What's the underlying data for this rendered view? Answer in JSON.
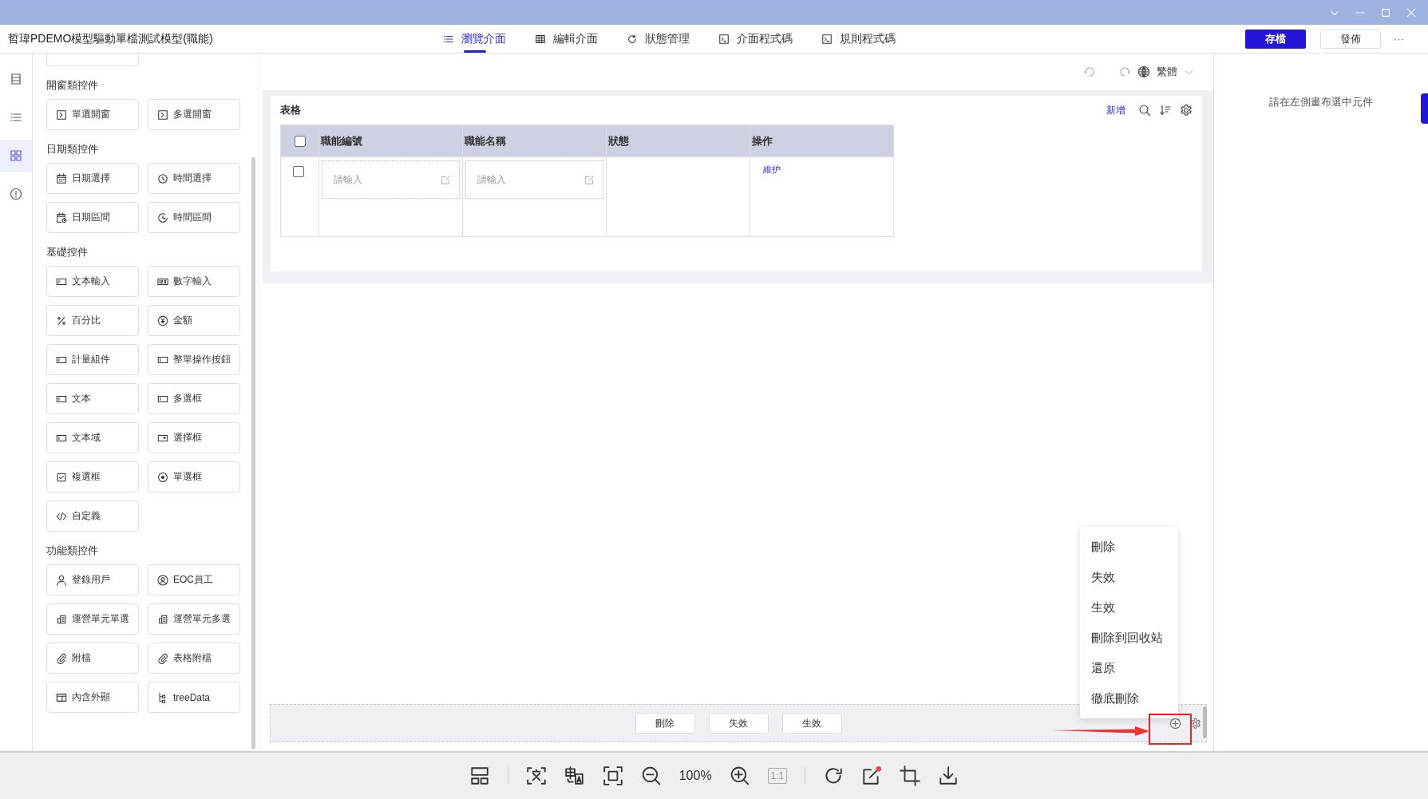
{
  "window": {
    "title": "哲瑋PDEMO模型驅動單檔測試模型(職能)"
  },
  "tabs": [
    {
      "label": "瀏覽介面",
      "selected": true,
      "kind": "list"
    },
    {
      "label": "編輯介面",
      "selected": false,
      "kind": "table"
    },
    {
      "label": "狀態管理",
      "selected": false,
      "kind": "refresh"
    },
    {
      "label": "介面程式碼",
      "selected": false,
      "kind": "terminal"
    },
    {
      "label": "規則程式碼",
      "selected": false,
      "kind": "terminal"
    }
  ],
  "header_buttons": {
    "save": "存檔",
    "publish": "發佈",
    "more": "···"
  },
  "rail": [
    {
      "kind": "form",
      "selected": false
    },
    {
      "kind": "list",
      "selected": false
    },
    {
      "kind": "grid",
      "selected": true
    },
    {
      "kind": "info",
      "selected": false
    }
  ],
  "palette": [
    {
      "title": "開窗類控件",
      "items": [
        {
          "label": "單選開窗",
          "kind": "popup"
        },
        {
          "label": "多選開窗",
          "kind": "popup"
        }
      ]
    },
    {
      "title": "日期類控件",
      "items": [
        {
          "label": "日期選擇",
          "kind": "calendar"
        },
        {
          "label": "時間選擇",
          "kind": "clock"
        },
        {
          "label": "日期區間",
          "kind": "date-range"
        },
        {
          "label": "時間區間",
          "kind": "time-range"
        }
      ]
    },
    {
      "title": "基礎控件",
      "items": [
        {
          "label": "文本輸入",
          "kind": "input"
        },
        {
          "label": "數字輸入",
          "kind": "number"
        },
        {
          "label": "百分比",
          "kind": "percent"
        },
        {
          "label": "金額",
          "kind": "money"
        },
        {
          "label": "計量組件",
          "kind": "input"
        },
        {
          "label": "整單操作按鈕",
          "kind": "input"
        },
        {
          "label": "文本",
          "kind": "input"
        },
        {
          "label": "多選框",
          "kind": "input"
        },
        {
          "label": "文本域",
          "kind": "input"
        },
        {
          "label": "選擇框",
          "kind": "select"
        },
        {
          "label": "複選框",
          "kind": "checkbox"
        },
        {
          "label": "單選框",
          "kind": "radio"
        },
        {
          "label": "自定義",
          "kind": "code"
        }
      ]
    },
    {
      "title": "功能類控件",
      "items": [
        {
          "label": "登錄用戶",
          "kind": "user"
        },
        {
          "label": "EOC員工",
          "kind": "user-circle"
        },
        {
          "label": "運營單元單選",
          "kind": "building"
        },
        {
          "label": "運營單元多選",
          "kind": "building"
        },
        {
          "label": "附檔",
          "kind": "clip"
        },
        {
          "label": "表格附檔",
          "kind": "clip"
        },
        {
          "label": "內含外顯",
          "kind": "card"
        },
        {
          "label": "treeData",
          "kind": "tree"
        }
      ]
    }
  ],
  "canvas_toolbar": {
    "language": "繁體"
  },
  "table_card": {
    "title": "表格",
    "add_link": "新增",
    "header_checked": false,
    "columns": [
      "職能編號",
      "職能名稱",
      "狀態",
      "操作"
    ],
    "rows": [
      {
        "checked": false,
        "code_placeholder": "請輸入",
        "name_placeholder": "請輸入",
        "action": "維护"
      }
    ]
  },
  "bottom_buttons": [
    "刪除",
    "失效",
    "生效"
  ],
  "menu": [
    "刪除",
    "失效",
    "生效",
    "刪除到回收站",
    "還原",
    "徹底刪除"
  ],
  "right_panel": {
    "hint": "請在左側畫布選中元件"
  },
  "viewer_toolbar": {
    "zoom": "100%",
    "ratio": "1:1"
  }
}
